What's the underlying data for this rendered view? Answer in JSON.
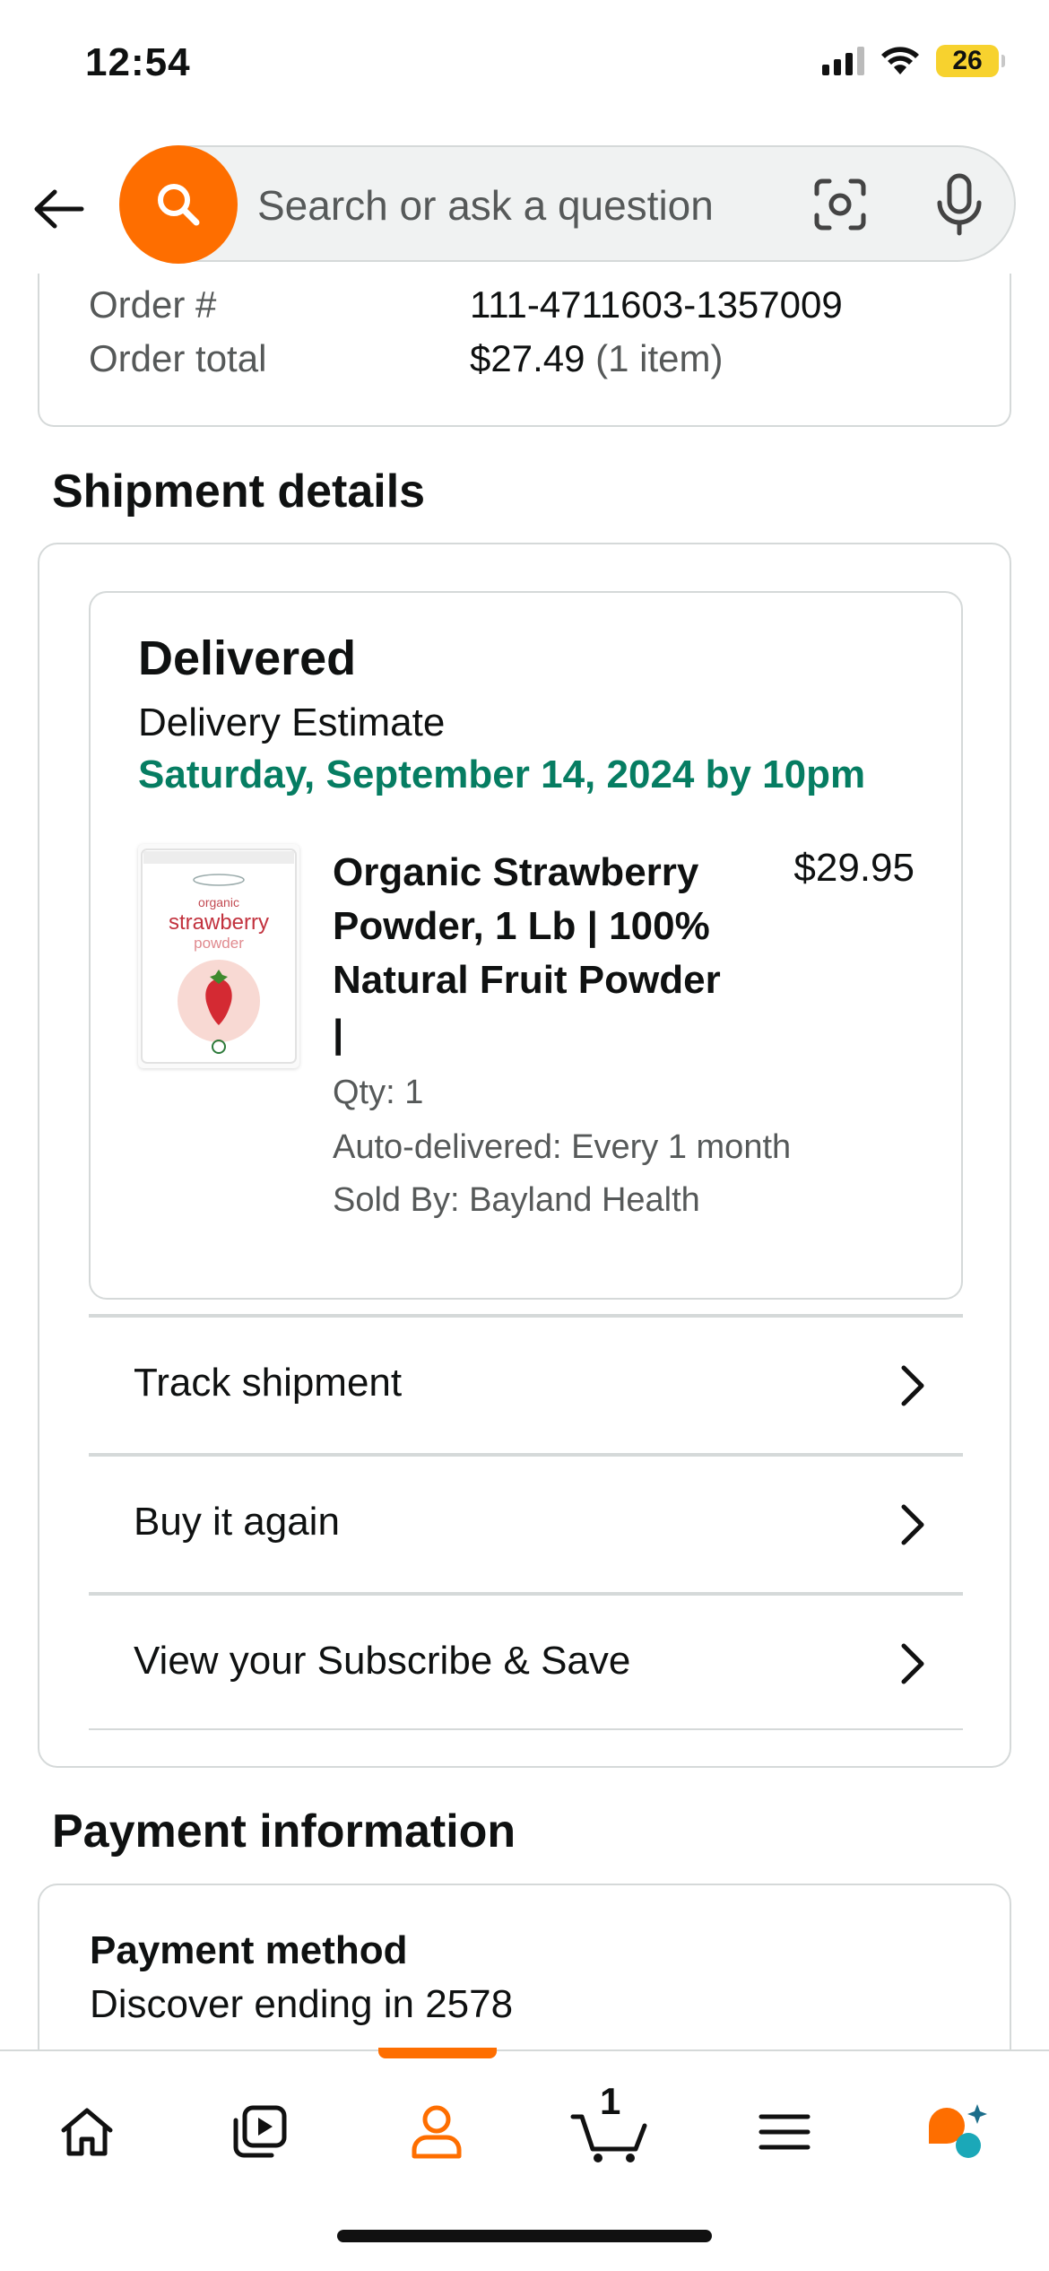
{
  "status_bar": {
    "time": "12:54",
    "battery": "26"
  },
  "search": {
    "placeholder": "Search or ask a question"
  },
  "order": {
    "number_label": "Order #",
    "number_value": "111-4711603-1357009",
    "total_label": "Order total",
    "total_value": "$27.49",
    "total_items": "(1 item)"
  },
  "shipment": {
    "section_title": "Shipment details",
    "status": "Delivered",
    "estimate_label": "Delivery Estimate",
    "estimate_date": "Saturday, September 14, 2024 by 10pm",
    "product": {
      "title": "Organic Strawberry Powder, 1 Lb | 100% Natural Fruit Powder |",
      "price": "$29.95",
      "qty": "Qty: 1",
      "auto_delivery": "Auto-delivered: Every 1 month",
      "sold_by": "Sold By: Bayland Health",
      "image_text_top": "organic",
      "image_text_main": "strawberry",
      "image_text_sub": "powder"
    },
    "actions": [
      {
        "label": "Track shipment"
      },
      {
        "label": "Buy it again"
      },
      {
        "label": "View your Subscribe & Save"
      }
    ]
  },
  "payment": {
    "section_title": "Payment information",
    "method_label": "Payment method",
    "method_value": "Discover ending in 2578"
  },
  "bottom_nav": {
    "items": [
      "home-icon",
      "video-icon",
      "account-icon",
      "cart-icon",
      "menu-icon",
      "rufus-icon"
    ],
    "cart_count": "1",
    "active_index": 2
  },
  "colors": {
    "accent": "#fe6e00",
    "delivery_green": "#067d62",
    "rufus_teal": "#1ba8b8"
  }
}
